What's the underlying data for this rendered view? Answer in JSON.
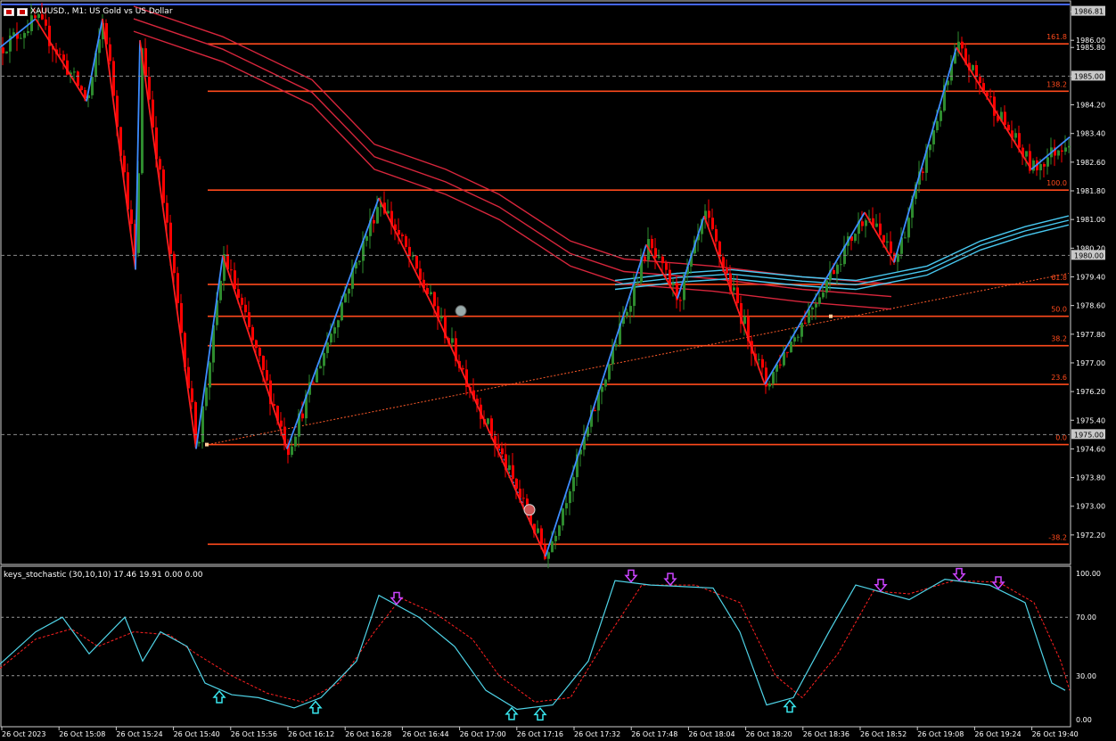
{
  "header": {
    "symbol": "XAUUSD.",
    "timeframe": "M1",
    "description": "US Gold vs US Dollar",
    "title_text": "XAUUSD., M1:  US Gold vs US Dollar"
  },
  "colors": {
    "background": "#000000",
    "bull": "#2e8b2e",
    "bear": "#ff0000",
    "fib": "#ff4a1c",
    "zigzag_up": "#3d8cff",
    "zigzag_down": "#ff1e1e",
    "ma_red": "#d8263c",
    "ma_cyan": "#48c8f0",
    "stoch_main": "#4fd4e8",
    "stoch_signal": "#ff2020",
    "arrow_down": "#cc44ff",
    "arrow_up": "#39e6ee"
  },
  "price_axis": {
    "labels": [
      "1986.80",
      "1986.00",
      "1985.80",
      "1985.00",
      "1984.20",
      "1983.40",
      "1982.60",
      "1981.80",
      "1981.00",
      "1980.20",
      "1979.40",
      "1978.60",
      "1977.80",
      "1977.00",
      "1976.20",
      "1975.40",
      "1974.60",
      "1973.80",
      "1973.00",
      "1972.20"
    ],
    "tags": [
      "1986.81",
      "1985.00",
      "1980.00",
      "1975.00"
    ]
  },
  "fib_levels": [
    {
      "label": "161.8",
      "price": 1985.9
    },
    {
      "label": "138.2",
      "price": 1984.58
    },
    {
      "label": "100.0",
      "price": 1981.82
    },
    {
      "label": "61.8",
      "price": 1979.19
    },
    {
      "label": "50.0",
      "price": 1978.3
    },
    {
      "label": "38.2",
      "price": 1977.48
    },
    {
      "label": "23.6",
      "price": 1976.4
    },
    {
      "label": "0.0",
      "price": 1974.72
    },
    {
      "label": "-38.2",
      "price": 1971.94
    }
  ],
  "time_axis": [
    "26 Oct 2023",
    "26 Oct 15:08",
    "26 Oct 15:24",
    "26 Oct 15:40",
    "26 Oct 15:56",
    "26 Oct 16:12",
    "26 Oct 16:28",
    "26 Oct 16:44",
    "26 Oct 17:00",
    "26 Oct 17:16",
    "26 Oct 17:32",
    "26 Oct 17:48",
    "26 Oct 18:04",
    "26 Oct 18:20",
    "26 Oct 18:36",
    "26 Oct 18:52",
    "26 Oct 19:08",
    "26 Oct 19:24",
    "26 Oct 19:40"
  ],
  "oscillator": {
    "title": "keys_stochastic (30,10,10) 17.46 19.91 0.00 0.00",
    "labels": [
      "100.00",
      "70.00",
      "30.00",
      "0.00"
    ]
  },
  "chart_data": {
    "type": "candlestick",
    "symbol": "XAUUSD.",
    "ylim": [
      1971.6,
      1987.0
    ],
    "zigzag": [
      [
        0,
        1985.8
      ],
      [
        40,
        1986.6
      ],
      [
        97,
        1984.3
      ],
      [
        115,
        1986.6
      ],
      [
        152,
        1979.6
      ],
      [
        157,
        1986.0
      ],
      [
        220,
        1974.6
      ],
      [
        250,
        1980.0
      ],
      [
        322,
        1974.6
      ],
      [
        425,
        1981.6
      ],
      [
        485,
        1978.6
      ],
      [
        612,
        1971.6
      ],
      [
        725,
        1980.3
      ],
      [
        760,
        1978.8
      ],
      [
        790,
        1981.1
      ],
      [
        858,
        1976.4
      ],
      [
        970,
        1981.2
      ],
      [
        1003,
        1979.8
      ],
      [
        1073,
        1985.8
      ],
      [
        1157,
        1982.4
      ],
      [
        1200,
        1983.3
      ]
    ],
    "stoch_main": [
      [
        0,
        38
      ],
      [
        40,
        60
      ],
      [
        70,
        70
      ],
      [
        100,
        45
      ],
      [
        140,
        70
      ],
      [
        160,
        40
      ],
      [
        180,
        60
      ],
      [
        210,
        50
      ],
      [
        230,
        25
      ],
      [
        260,
        17
      ],
      [
        290,
        15
      ],
      [
        330,
        8
      ],
      [
        360,
        15
      ],
      [
        400,
        40
      ],
      [
        425,
        85
      ],
      [
        470,
        70
      ],
      [
        510,
        50
      ],
      [
        545,
        20
      ],
      [
        580,
        7
      ],
      [
        620,
        10
      ],
      [
        660,
        40
      ],
      [
        690,
        95
      ],
      [
        730,
        92
      ],
      [
        800,
        90
      ],
      [
        830,
        60
      ],
      [
        860,
        10
      ],
      [
        890,
        15
      ],
      [
        930,
        60
      ],
      [
        960,
        92
      ],
      [
        990,
        87
      ],
      [
        1020,
        82
      ],
      [
        1060,
        96
      ],
      [
        1110,
        92
      ],
      [
        1150,
        80
      ],
      [
        1180,
        25
      ],
      [
        1195,
        20
      ]
    ],
    "stoch_signal": [
      [
        0,
        35
      ],
      [
        40,
        55
      ],
      [
        80,
        62
      ],
      [
        110,
        50
      ],
      [
        150,
        60
      ],
      [
        190,
        58
      ],
      [
        220,
        45
      ],
      [
        260,
        30
      ],
      [
        300,
        18
      ],
      [
        340,
        12
      ],
      [
        380,
        25
      ],
      [
        420,
        60
      ],
      [
        450,
        83
      ],
      [
        490,
        72
      ],
      [
        530,
        55
      ],
      [
        560,
        30
      ],
      [
        600,
        12
      ],
      [
        640,
        15
      ],
      [
        680,
        55
      ],
      [
        720,
        92
      ],
      [
        780,
        92
      ],
      [
        830,
        80
      ],
      [
        870,
        30
      ],
      [
        900,
        15
      ],
      [
        940,
        45
      ],
      [
        980,
        88
      ],
      [
        1020,
        86
      ],
      [
        1070,
        95
      ],
      [
        1120,
        94
      ],
      [
        1160,
        80
      ],
      [
        1190,
        40
      ],
      [
        1200,
        20
      ]
    ],
    "down_arrows": [
      445,
      708,
      752,
      988,
      1076,
      1120
    ],
    "up_arrows": [
      246,
      354,
      574,
      606,
      886
    ]
  }
}
